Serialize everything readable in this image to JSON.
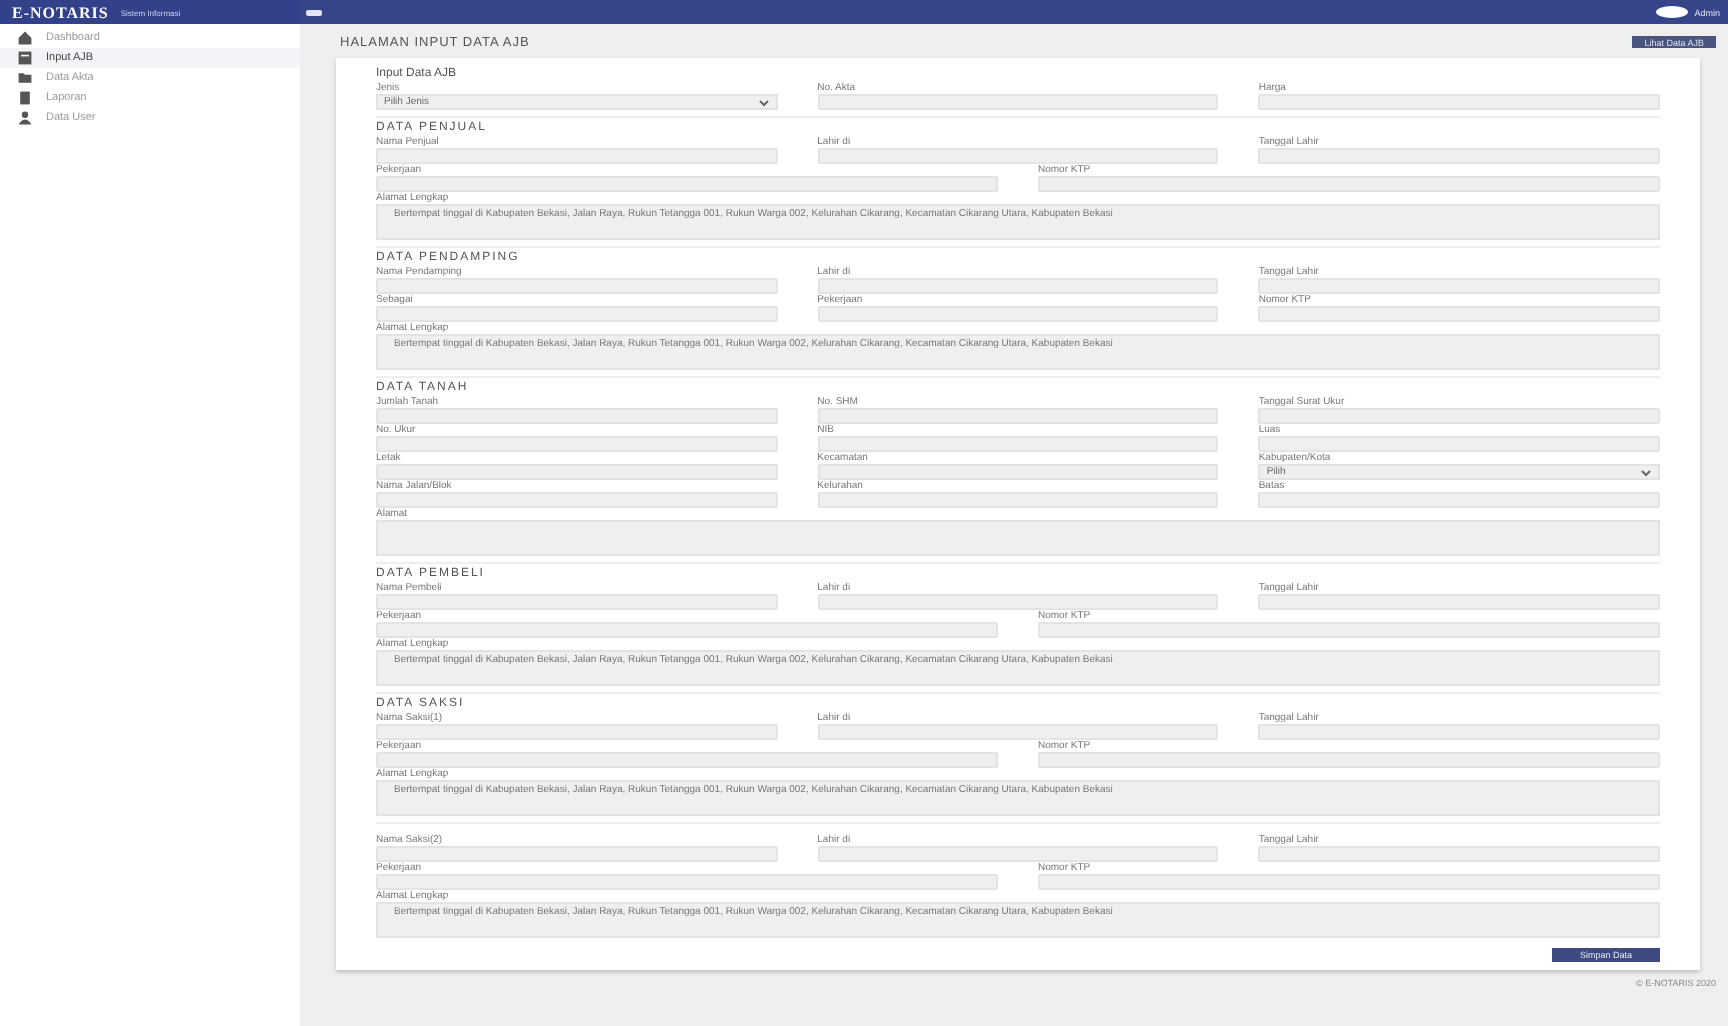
{
  "sidebar": {
    "brand": "E-NOTARIS",
    "subtitle": "Sistem Informasi",
    "items": [
      {
        "label": "Dashboard",
        "selected": false
      },
      {
        "label": "Input AJB",
        "selected": true
      },
      {
        "label": "Data Akta",
        "selected": false
      },
      {
        "label": "Laporan",
        "selected": false
      },
      {
        "label": "Data User",
        "selected": false
      }
    ]
  },
  "topbar": {
    "user": "Admin"
  },
  "page": {
    "title": "HALAMAN INPUT DATA AJB",
    "button": "Lihat Data AJB"
  },
  "form": {
    "sections": [
      {
        "title": "Input Data AJB",
        "rows": [
          [
            {
              "label": "Jenis",
              "kind": "select",
              "value": "Pilih Jenis"
            },
            {
              "label": "No. Akta",
              "kind": "text"
            },
            {
              "label": "Harga",
              "kind": "text"
            }
          ]
        ]
      },
      {
        "title": "DATA PENJUAL",
        "rows": [
          [
            {
              "label": "Nama Penjual",
              "kind": "text"
            },
            {
              "label": "Lahir di",
              "kind": "text"
            },
            {
              "label": "Tanggal Lahir",
              "kind": "text"
            }
          ],
          [
            {
              "label": "Pekerjaan",
              "kind": "text"
            },
            {
              "label": "Nomor KTP",
              "kind": "text"
            }
          ],
          [
            {
              "label": "Alamat Lengkap",
              "kind": "textarea",
              "placeholder": "Bertempat tinggal di Kabupaten Bekasi, Jalan Raya, Rukun Tetangga 001, Rukun Warga 002, Kelurahan Cikarang, Kecamatan Cikarang Utara, Kabupaten Bekasi"
            }
          ]
        ]
      },
      {
        "title": "DATA PENDAMPING",
        "rows": [
          [
            {
              "label": "Nama Pendamping",
              "kind": "text"
            },
            {
              "label": "Lahir di",
              "kind": "text"
            },
            {
              "label": "Tanggal Lahir",
              "kind": "text"
            }
          ],
          [
            {
              "label": "Sebagai",
              "kind": "text"
            },
            {
              "label": "Pekerjaan",
              "kind": "text"
            },
            {
              "label": "Nomor KTP",
              "kind": "text"
            }
          ],
          [
            {
              "label": "Alamat Lengkap",
              "kind": "textarea",
              "placeholder": "Bertempat tinggal di Kabupaten Bekasi, Jalan Raya, Rukun Tetangga 001, Rukun Warga 002, Kelurahan Cikarang, Kecamatan Cikarang Utara, Kabupaten Bekasi"
            }
          ]
        ]
      },
      {
        "title": "DATA TANAH",
        "rows": [
          [
            {
              "label": "Jumlah Tanah",
              "kind": "text"
            },
            {
              "label": "No. SHM",
              "kind": "text"
            },
            {
              "label": "Tanggal Surat Ukur",
              "kind": "text"
            }
          ],
          [
            {
              "label": "No. Ukur",
              "kind": "text"
            },
            {
              "label": "NIB",
              "kind": "text"
            },
            {
              "label": "Luas",
              "kind": "text"
            }
          ],
          [
            {
              "label": "Letak",
              "kind": "text"
            },
            {
              "label": "Kecamatan",
              "kind": "text"
            },
            {
              "label": "Kabupaten/Kota",
              "kind": "select",
              "value": "Pilih"
            }
          ],
          [
            {
              "label": "Nama Jalan/Blok",
              "kind": "text"
            },
            {
              "label": "Kelurahan",
              "kind": "text"
            },
            {
              "label": "Batas",
              "kind": "text"
            }
          ],
          [
            {
              "label": "Alamat",
              "kind": "textarea"
            }
          ]
        ]
      },
      {
        "title": "DATA PEMBELI",
        "rows": [
          [
            {
              "label": "Nama Pembeli",
              "kind": "text"
            },
            {
              "label": "Lahir di",
              "kind": "text"
            },
            {
              "label": "Tanggal Lahir",
              "kind": "text"
            }
          ],
          [
            {
              "label": "Pekerjaan",
              "kind": "text"
            },
            {
              "label": "Nomor KTP",
              "kind": "text"
            }
          ],
          [
            {
              "label": "Alamat Lengkap",
              "kind": "textarea",
              "placeholder": "Bertempat tinggal di Kabupaten Bekasi, Jalan Raya, Rukun Tetangga 001, Rukun Warga 002, Kelurahan Cikarang, Kecamatan Cikarang Utara, Kabupaten Bekasi"
            }
          ]
        ]
      },
      {
        "title": "DATA SAKSI",
        "rows": [
          [
            {
              "label": "Nama Saksi(1)",
              "kind": "text"
            },
            {
              "label": "Lahir di",
              "kind": "text"
            },
            {
              "label": "Tanggal Lahir",
              "kind": "text"
            }
          ],
          [
            {
              "label": "Pekerjaan",
              "kind": "text"
            },
            {
              "label": "Nomor KTP",
              "kind": "text"
            }
          ],
          [
            {
              "label": "Alamat Lengkap",
              "kind": "textarea",
              "placeholder": "Bertempat tinggal di Kabupaten Bekasi, Jalan Raya, Rukun Tetangga 001, Rukun Warga 002, Kelurahan Cikarang, Kecamatan Cikarang Utara, Kabupaten Bekasi"
            }
          ]
        ]
      },
      {
        "rows": [
          [
            {
              "label": "Nama Saksi(2)",
              "kind": "text"
            },
            {
              "label": "Lahir di",
              "kind": "text"
            },
            {
              "label": "Tanggal Lahir",
              "kind": "text"
            }
          ],
          [
            {
              "label": "Pekerjaan",
              "kind": "text"
            },
            {
              "label": "Nomor KTP",
              "kind": "text"
            }
          ],
          [
            {
              "label": "Alamat Lengkap",
              "kind": "textarea",
              "placeholder": "Bertempat tinggal di Kabupaten Bekasi, Jalan Raya, Rukun Tetangga 001, Rukun Warga 002, Kelurahan Cikarang, Kecamatan Cikarang Utara, Kabupaten Bekasi"
            }
          ]
        ]
      }
    ],
    "submit": "Simpan Data"
  },
  "footer": "© E-NOTARIS 2020"
}
